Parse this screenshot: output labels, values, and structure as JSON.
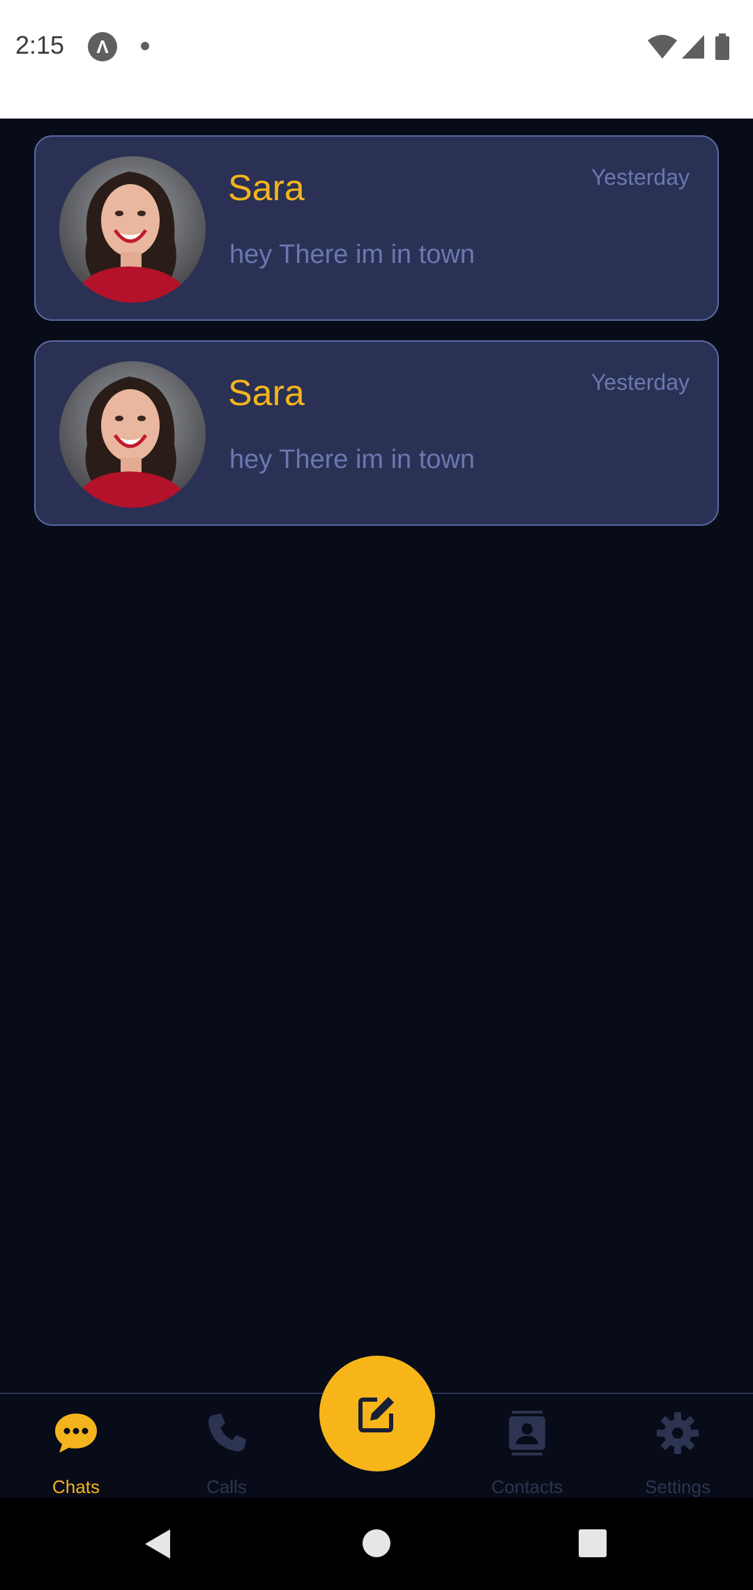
{
  "status_bar": {
    "time": "2:15",
    "app_icon_glyph": "Λ"
  },
  "chats": [
    {
      "name": "Sara",
      "time": "Yesterday",
      "message": "hey There im in town",
      "avatar": "woman-portrait"
    },
    {
      "name": "Sara",
      "time": "Yesterday",
      "message": "hey There im in town",
      "avatar": "woman-portrait"
    }
  ],
  "bottom_nav": {
    "items": [
      {
        "label": "Chats",
        "icon": "chat-bubble-icon",
        "active": true
      },
      {
        "label": "Calls",
        "icon": "phone-icon",
        "active": false
      },
      {
        "label": "Contacts",
        "icon": "contacts-icon",
        "active": false
      },
      {
        "label": "Settings",
        "icon": "gear-icon",
        "active": false
      }
    ],
    "fab_icon": "compose-icon"
  },
  "colors": {
    "accent": "#f4b41d",
    "background": "#080c18",
    "card": "#2a3154",
    "card_border": "#5b6aa6",
    "muted_text": "#6b78b0",
    "inactive_nav": "#2c3452"
  }
}
